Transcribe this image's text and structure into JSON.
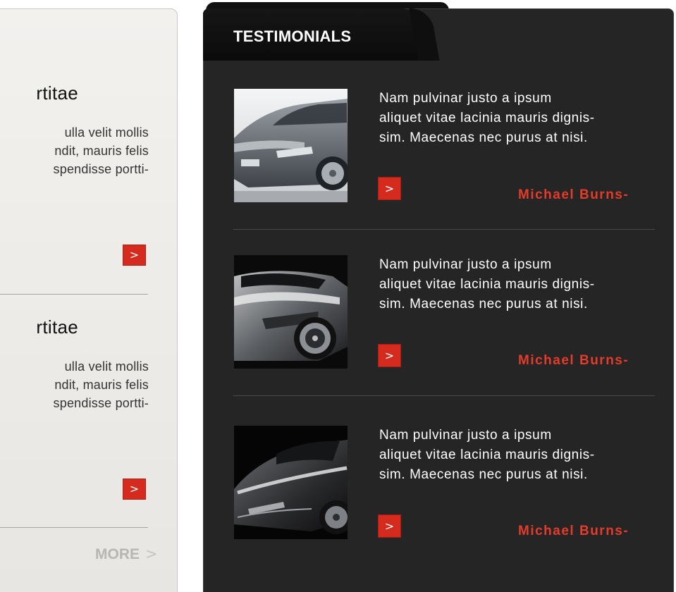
{
  "left_panel": {
    "items": [
      {
        "title": "rtitae",
        "lines": [
          "ulla velit mollis",
          "ndit, mauris felis",
          "spendisse portti-"
        ]
      },
      {
        "title": "rtitae",
        "lines": [
          "ulla velit mollis",
          "ndit, mauris felis",
          "spendisse portti-"
        ]
      }
    ],
    "more_label": "MORE",
    "arrow_glyph": ">",
    "more_glyph": ">"
  },
  "testimonials": {
    "heading": "TESTIMONIALS",
    "items": [
      {
        "lines": [
          "Nam pulvinar justo a ipsum",
          "aliquet vitae lacinia mauris dignis-",
          "sim. Maecenas nec purus at nisi."
        ],
        "author": "Michael Burns-",
        "image": "silver-car-photo"
      },
      {
        "lines": [
          "Nam pulvinar justo a ipsum",
          "aliquet vitae lacinia mauris dignis-",
          "sim. Maecenas nec purus at nisi."
        ],
        "author": "Michael Burns-",
        "image": "sports-car-side-photo"
      },
      {
        "lines": [
          "Nam pulvinar justo a ipsum",
          "aliquet vitae lacinia mauris dignis-",
          "sim. Maecenas nec purus at nisi."
        ],
        "author": "Michael Burns-",
        "image": "sports-car-front-photo"
      }
    ],
    "arrow_glyph": ">"
  },
  "colors": {
    "accent_red": "#d42b1e",
    "author_red": "#e53b2a",
    "dark_panel": "#252525",
    "light_panel": "#efeeeb"
  }
}
